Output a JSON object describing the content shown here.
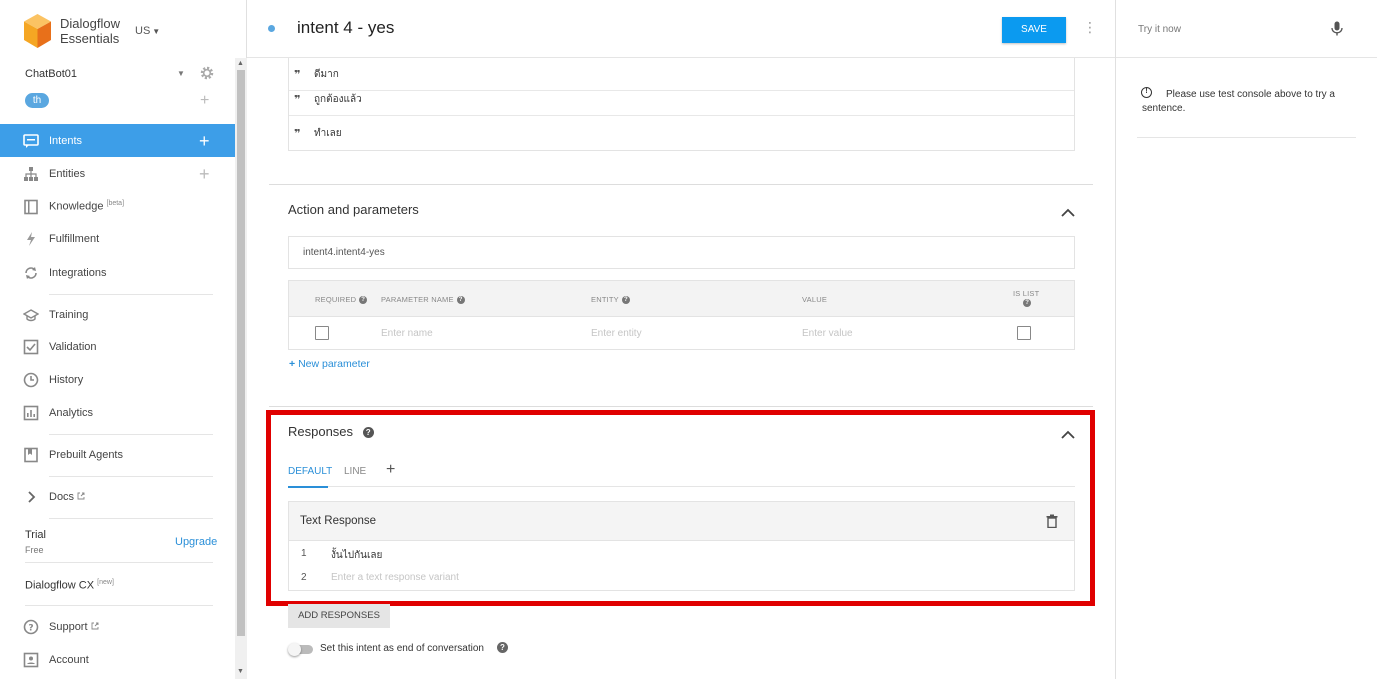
{
  "brand": {
    "name_line1": "Dialogflow",
    "name_line2": "Essentials",
    "region": "US",
    "colors": {
      "cube_left": "#f5a623",
      "cube_right": "#e8701a",
      "cube_top": "#fbc363"
    }
  },
  "agent": {
    "name": "ChatBot01",
    "language": "th"
  },
  "nav": {
    "intents": "Intents",
    "entities": "Entities",
    "knowledge": "Knowledge",
    "knowledge_badge": "[beta]",
    "fulfillment": "Fulfillment",
    "integrations": "Integrations",
    "training": "Training",
    "validation": "Validation",
    "history": "History",
    "analytics": "Analytics",
    "prebuilt_agents": "Prebuilt Agents",
    "docs": "Docs",
    "trial": "Trial",
    "trial_sub": "Free",
    "upgrade": "Upgrade",
    "cx": "Dialogflow CX",
    "cx_badge": "[new]",
    "support": "Support",
    "account": "Account"
  },
  "header": {
    "intent_name": "intent 4 - yes",
    "save_label": "SAVE"
  },
  "training_phrases": [
    "ดีมาก",
    "ถูกต้องแล้ว",
    "ทำเลย"
  ],
  "action_section": {
    "title": "Action and parameters",
    "action_value": "intent4.intent4-yes",
    "columns": {
      "required": "REQUIRED",
      "parameter_name": "PARAMETER NAME",
      "entity": "ENTITY",
      "value": "VALUE",
      "is_list": "IS LIST"
    },
    "placeholders": {
      "name": "Enter name",
      "entity": "Enter entity",
      "value": "Enter value"
    },
    "new_parameter": "New parameter"
  },
  "responses": {
    "title": "Responses",
    "tabs": [
      "DEFAULT",
      "LINE"
    ],
    "text_response_title": "Text Response",
    "rows": [
      {
        "num": "1",
        "text": "งั้นไปกันเลย"
      },
      {
        "num": "2",
        "placeholder": "Enter a text response variant"
      }
    ],
    "add_responses": "ADD RESPONSES",
    "end_conversation": "Set this intent as end of conversation",
    "highlight_color": "#e00000"
  },
  "right_panel": {
    "try_placeholder": "Try it now",
    "notice": "Please use test console above to try a sentence."
  },
  "accent_color": "#3d9ee8"
}
